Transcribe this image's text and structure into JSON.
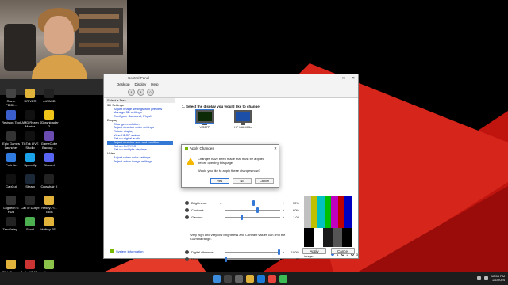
{
  "desktop_icons": [
    {
      "label": "Ravn-PB.DI...",
      "color": "#444444"
    },
    {
      "label": "DRIVER",
      "color": "#e2b33a"
    },
    {
      "label": "mWASD",
      "color": "#222222"
    },
    {
      "label": "Revision Tool",
      "color": "#3a5fcd"
    },
    {
      "label": "AMD Ryzen Master",
      "color": "#111111"
    },
    {
      "label": "JDownloader 2",
      "color": "#f0c419"
    },
    {
      "label": "Epic Games Launcher",
      "color": "#333333"
    },
    {
      "label": "TikTok LIVE Studio",
      "color": "#111111"
    },
    {
      "label": "GameCube Backup ...",
      "color": "#6a4cb0"
    },
    {
      "label": "Fortnite",
      "color": "#2f7be0"
    },
    {
      "label": "Speedify",
      "color": "#1aa3e8"
    },
    {
      "label": "Discord",
      "color": "#5865f2"
    },
    {
      "label": "CapCut",
      "color": "#111111"
    },
    {
      "label": "Steam",
      "color": "#1b2838"
    },
    {
      "label": "Crosshair X",
      "color": "#222222"
    },
    {
      "label": "Logitech G HUB",
      "color": "#333333"
    },
    {
      "label": "Call of Duty®",
      "color": "#2a2a2a"
    },
    {
      "label": "Rekey-Fl... Tools",
      "color": "#e2b33a"
    },
    {
      "label": "ZeroDelay...",
      "color": "#222222"
    },
    {
      "label": "Scroll",
      "color": "#4caf50"
    },
    {
      "label": "Hotkey FF...",
      "color": "#e2b33a"
    },
    {
      "label": "ClickCleaner - Shortcut",
      "color": "#e2b33a"
    },
    {
      "label": "Anduril/F4S...",
      "color": "#cc3333"
    },
    {
      "label": "Hosmos Configurat...",
      "color": "#8bc34a"
    },
    {
      "label": "Settings",
      "color": "#e2b33a"
    },
    {
      "label": "FFScaler 1...",
      "color": "#e2b33a"
    }
  ],
  "nvidia": {
    "window_title": "Control Panel",
    "menu": [
      "Desktop",
      "Display",
      "Help"
    ],
    "task_header": "Select a Task...",
    "tree": [
      {
        "label": "3D Settings",
        "level": 0
      },
      {
        "label": "Adjust image settings with preview",
        "level": 1
      },
      {
        "label": "Manage 3D settings",
        "level": 1
      },
      {
        "label": "Configure Surround, PhysX",
        "level": 1
      },
      {
        "label": "Display",
        "level": 0
      },
      {
        "label": "Change resolution",
        "level": 1
      },
      {
        "label": "Adjust desktop color settings",
        "level": 1
      },
      {
        "label": "Rotate display",
        "level": 1
      },
      {
        "label": "View HDCP status",
        "level": 1
      },
      {
        "label": "Set up digital audio",
        "level": 1
      },
      {
        "label": "Adjust desktop size and position",
        "level": 1,
        "selected": true
      },
      {
        "label": "Set up G-SYNC",
        "level": 1
      },
      {
        "label": "Set up multiple displays",
        "level": 1
      },
      {
        "label": "Video",
        "level": 0
      },
      {
        "label": "Adjust video color settings",
        "level": 1
      },
      {
        "label": "Adjust video image settings",
        "level": 1
      }
    ],
    "system_info": "System Information",
    "step1": "1. Select the display you would like to change.",
    "monitors": [
      {
        "label": "VG27P",
        "selected": true
      },
      {
        "label": "HP LA2405x",
        "selected": false
      }
    ],
    "sliders": [
      {
        "name": "Brightness:",
        "value": "52%",
        "level": 0.52
      },
      {
        "name": "Contrast:",
        "value": "60%",
        "level": 0.6
      },
      {
        "name": "Gamma:",
        "value": "1.00",
        "level": 0.3
      }
    ],
    "note": "Very high and very low Brightness and Contrast values can limit the Gamma range.",
    "sliders2": [
      {
        "name": "Digital vibrance:",
        "value": "100%",
        "level": 1.0
      },
      {
        "name": "Hue:",
        "value": "0°",
        "level": 0.0
      }
    ],
    "reference_label": "Reference image:",
    "reference_options": [
      "1",
      "2",
      "3"
    ],
    "apply_label": "Apply",
    "cancel_label": "Cancel"
  },
  "dialog": {
    "title": "Apply Changes",
    "message": "Changes have been made that must be applied before opening this page.",
    "question": "Would you like to apply these changes now?",
    "yes": "Yes",
    "no": "No",
    "cancel": "Cancel"
  },
  "taskbar": {
    "time": "12:58 PM",
    "date": "2/1/2024",
    "icons": [
      "#3c8dde",
      "#444444",
      "#666666",
      "#e2b33a",
      "#1b7ad8",
      "#e8433c",
      "#3cba54"
    ]
  },
  "colors": {
    "accent": "#3478d6",
    "nvidia_green": "#76b900",
    "wallpaper_red": "#d6261c"
  }
}
